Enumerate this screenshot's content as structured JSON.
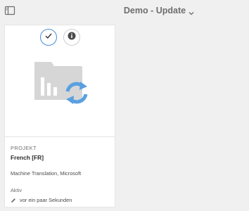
{
  "header": {
    "title": "Demo - Update"
  },
  "card": {
    "type_label": "PROJEKT",
    "title": "French [FR]",
    "description": "Machine Translation, Microsoft",
    "status": "Aktiv",
    "modified": "vor ein paar Sekunden"
  },
  "colors": {
    "accent": "#4a8bd6",
    "sync_icon": "#5aa0e0",
    "thumbnail_gray": "#d6d6d6",
    "background": "#f0f0f0"
  },
  "icons": {
    "rail_toggle": "rail-toggle-icon",
    "title_dropdown": "chevron-down-icon",
    "select": "checkmark-icon",
    "info": "info-icon",
    "thumbnail": "chart-placeholder-icon",
    "sync": "sync-icon",
    "modified": "pencil-icon"
  }
}
